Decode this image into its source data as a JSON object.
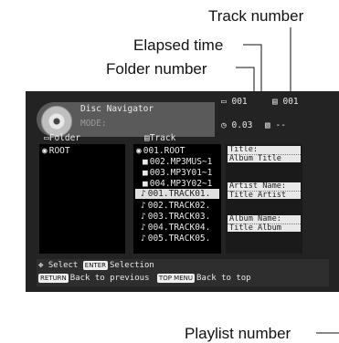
{
  "callouts": {
    "track_number": "Track number",
    "elapsed_time": "Elapsed time",
    "folder_number": "Folder number",
    "playlist_number": "Playlist number"
  },
  "screen": {
    "title": "Disc Navigator",
    "mode": "MODE:",
    "folder_no": "001",
    "track_no": "001",
    "elapsed": "0.03",
    "playlist": "--",
    "folder_header": "Folder",
    "track_header": "Track",
    "folders": [
      "ROOT"
    ],
    "tracks": [
      "001.ROOT",
      "002.MP3MUS~1",
      "003.MP3Y01~1",
      "004.MP3Y02~1",
      "001.TRACK01.",
      "002.TRACK02.",
      "003.TRACK03.",
      "004.TRACK04.",
      "005.TRACK05."
    ],
    "selected_track_index": 4,
    "info": {
      "title_label": "Title:",
      "title_value": "Album Title",
      "artist_label": "Artist Name:",
      "artist_value": "Title Artist",
      "album_label": "Album Name:",
      "album_value": "Title Album"
    },
    "footer": {
      "select_text": "Select",
      "enter_key": "ENTER",
      "selection_text": "Selection",
      "return_key": "RETURN",
      "back_prev": "Back to previous",
      "topmenu_key": "TOP MENU",
      "back_top": "Back to top"
    }
  },
  "colors": {
    "screen_bg": "#232323",
    "panel_bg": "#000000",
    "highlight": "#e0e0e0"
  }
}
